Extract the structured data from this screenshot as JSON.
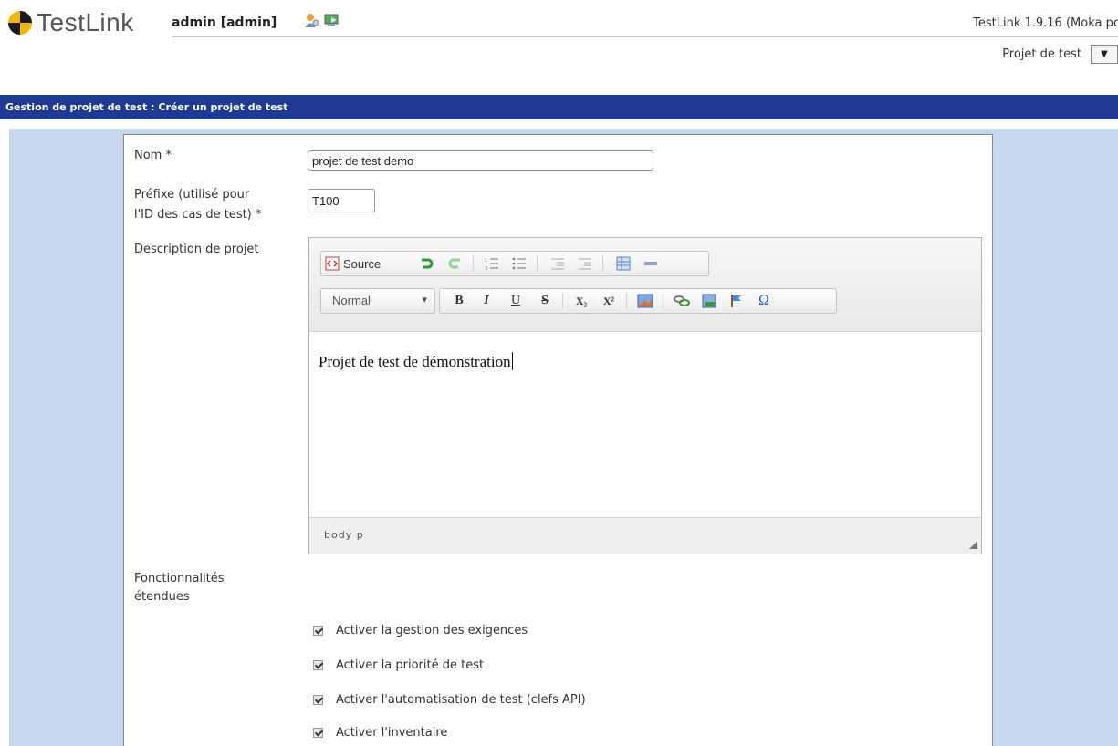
{
  "header": {
    "logo_text": "TestLink",
    "user": "admin [admin]",
    "version": "TestLink 1.9.16 (Moka pc",
    "project_label": "Projet de test",
    "project_select_glyph": "▼"
  },
  "titlebar": {
    "text": "Gestion de projet de test : Créer un projet de test"
  },
  "form": {
    "name_label": "Nom *",
    "name_value": "projet de test demo",
    "prefix_label_1": "Préfixe (utilisé pour",
    "prefix_label_2": "l'ID des cas de test) *",
    "prefix_value": "T100",
    "description_label": "Description de projet",
    "extended_label_1": "Fonctionnalités",
    "extended_label_2": "étendues"
  },
  "editor": {
    "source_label": "Source",
    "format_value": "Normal",
    "format_caret": "▾",
    "bold": "B",
    "italic": "I",
    "underline": "U",
    "strike": "S",
    "subscript": "X₂",
    "superscript": "X²",
    "omega": "Ω",
    "content": "Projet de test de démonstration",
    "path": "body  p"
  },
  "checkboxes": [
    {
      "label": "Activer la gestion des exigences",
      "checked": true
    },
    {
      "label": "Activer la priorité de test",
      "checked": true
    },
    {
      "label": "Activer l'automatisation de test (clefs API)",
      "checked": true
    },
    {
      "label": "Activer l'inventaire",
      "checked": true
    }
  ],
  "colors": {
    "titlebar": "#1f3a93",
    "work_bg": "#c8d7ee",
    "accent_green": "#3aa53a"
  }
}
